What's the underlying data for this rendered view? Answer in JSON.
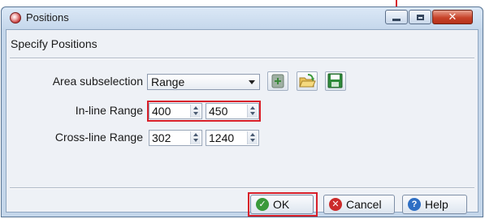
{
  "window": {
    "title": "Positions",
    "minimize_glyph": "minimize-icon",
    "maximize_glyph": "maximize-icon",
    "close_label": "✕"
  },
  "heading": "Specify Positions",
  "area": {
    "label": "Area subselection",
    "selected": "Range",
    "icon_buttons": [
      "filter-icon",
      "open-folder-icon",
      "save-icon"
    ]
  },
  "inline": {
    "label": "In-line Range",
    "from": "400",
    "to": "450"
  },
  "crossline": {
    "label": "Cross-line Range",
    "from": "302",
    "to": "1240"
  },
  "buttons": {
    "ok": "OK",
    "cancel": "Cancel",
    "help": "Help"
  },
  "colors": {
    "highlight": "#d8202a",
    "ok_icon": "#3a9a3a",
    "cancel_icon": "#cc2b2b",
    "help_icon": "#2f6fc4"
  }
}
